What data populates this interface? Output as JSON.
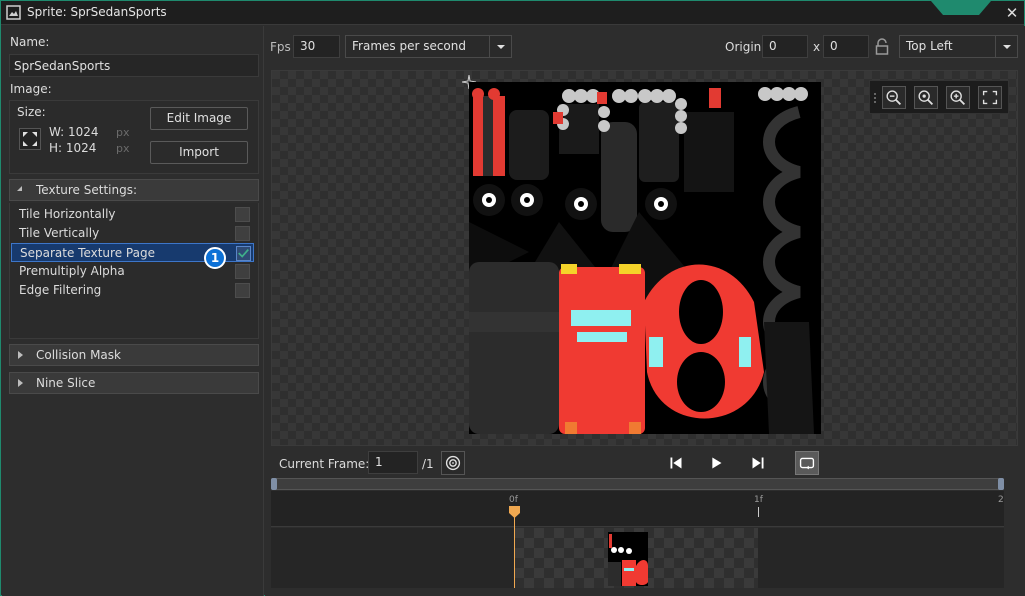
{
  "window": {
    "title": "Sprite: SprSedanSports",
    "close_glyph": "✕"
  },
  "left": {
    "name_label": "Name:",
    "name_value": "SprSedanSports",
    "image_label": "Image:",
    "size_label": "Size:",
    "width_text": "W: 1024",
    "height_text": "H: 1024",
    "px_unit": "px",
    "edit_image_label": "Edit Image",
    "import_label": "Import",
    "texture_settings_label": "Texture Settings:",
    "texture_options": [
      {
        "label": "Tile Horizontally",
        "checked": false
      },
      {
        "label": "Tile Vertically",
        "checked": false
      },
      {
        "label": "Separate Texture Page",
        "checked": true,
        "selected": true
      },
      {
        "label": "Premultiply Alpha",
        "checked": false
      },
      {
        "label": "Edge Filtering",
        "checked": false
      }
    ],
    "badge_number": "1",
    "collision_mask_label": "Collision Mask",
    "nine_slice_label": "Nine Slice"
  },
  "toolbar": {
    "fps_label": "Fps",
    "fps_value": "30",
    "speed_mode": "Frames per second",
    "origin_label": "Origin",
    "origin_x": "0",
    "x_sep": "x",
    "origin_y": "0",
    "origin_preset": "Top Left"
  },
  "zoom": {
    "icons": [
      "zoom-out-icon",
      "zoom-reset-icon",
      "zoom-in-icon",
      "fullscreen-icon"
    ]
  },
  "playback": {
    "current_frame_label": "Current Frame:",
    "current_frame_value": "1",
    "frame_total": "/1"
  },
  "timeline": {
    "ticks": [
      "0f",
      "1f",
      "2"
    ]
  },
  "colors": {
    "accent": "#1f8a6e",
    "selection": "#173a6e",
    "badge": "#0d71d6",
    "playhead": "#f0a850",
    "sprite_red": "#f03a32"
  }
}
